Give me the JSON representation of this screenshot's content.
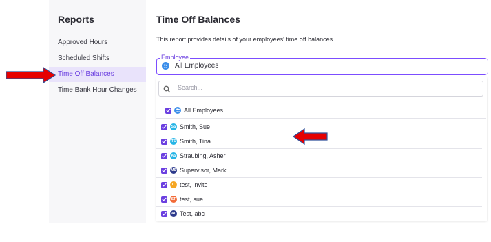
{
  "sidebar": {
    "title": "Reports",
    "items": [
      {
        "label": "Approved Hours"
      },
      {
        "label": "Scheduled Shifts"
      },
      {
        "label": "Time Off Balances"
      },
      {
        "label": "Time Bank Hour Changes"
      }
    ]
  },
  "main": {
    "title": "Time Off Balances",
    "description": "This report provides details of your employees' time off balances."
  },
  "employee_field": {
    "legend": "Employee",
    "value": "All Employees"
  },
  "search": {
    "placeholder": "Search..."
  },
  "options": [
    {
      "label": "All Employees",
      "initials": "",
      "color": "#3b8eea"
    },
    {
      "label": "Smith, Sue",
      "initials": "SS",
      "color": "#26b5e6"
    },
    {
      "label": "Smith, Tina",
      "initials": "TS",
      "color": "#26b5e6"
    },
    {
      "label": "Straubing, Asher",
      "initials": "AS",
      "color": "#26b5e6"
    },
    {
      "label": "Supervisor, Mark",
      "initials": "MS",
      "color": "#2d3a8c"
    },
    {
      "label": "test, invite",
      "initials": "IT",
      "color": "#f5a623"
    },
    {
      "label": "test, sue",
      "initials": "ST",
      "color": "#f26b38"
    },
    {
      "label": "Test, abc",
      "initials": "AT",
      "color": "#2d3a8c"
    }
  ],
  "colors": {
    "accent": "#6b3fe0",
    "arrow": "#e60000"
  }
}
